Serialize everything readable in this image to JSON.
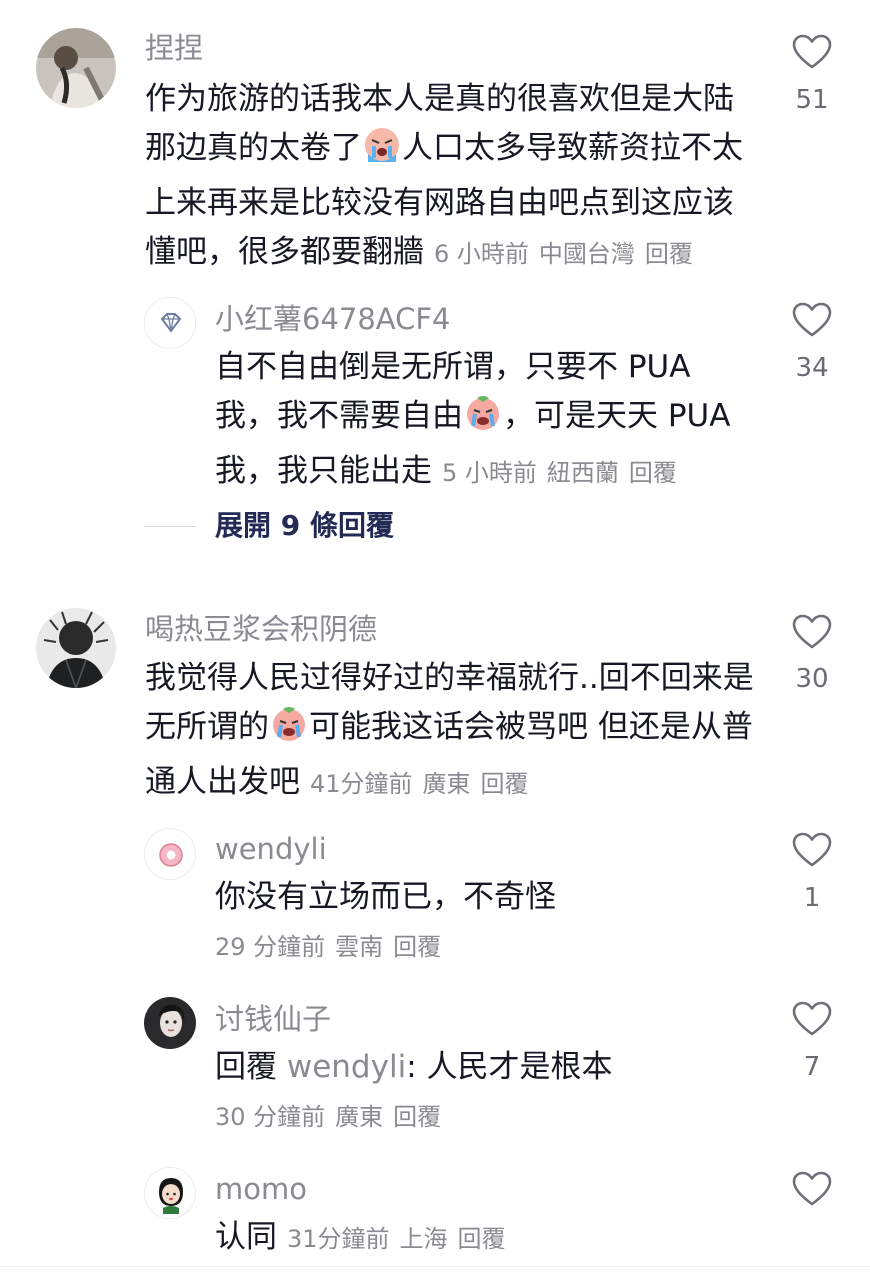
{
  "comments": [
    {
      "username": "捏捏",
      "lines": [
        "作为旅游的话我本人是真的很喜欢但是大陆",
        "那边真的太卷了",
        "人口太多导致薪资拉不太",
        "上来再来是比较没有网路自由吧点到这应该",
        "懂吧，很多都要翻牆"
      ],
      "time": "6 小時前",
      "location": "中國台灣",
      "reply": "回覆",
      "likes": "51",
      "emoji": "crying-face",
      "replies": [
        {
          "username": "小红薯6478ACF4",
          "lines": [
            "自不自由倒是无所谓，只要不 PUA",
            "我，我不需要自由",
            "，可是天天 PUA",
            "我，我只能出走"
          ],
          "time": "5 小時前",
          "location": "紐西蘭",
          "reply": "回覆",
          "likes": "34",
          "emoji": "crying-face"
        }
      ],
      "expand_label": "展開 9 條回覆"
    },
    {
      "username": "喝热豆浆会积阴德",
      "lines": [
        "我觉得人民过得好过的幸福就行..回不回来是",
        "无所谓的",
        "可能我这话会被骂吧 但还是从普",
        "通人出发吧"
      ],
      "time": "41分鐘前",
      "location": "廣東",
      "reply": "回覆",
      "likes": "30",
      "emoji": "crying-face",
      "replies": [
        {
          "username": "wendyli",
          "text": "你没有立场而已，不奇怪",
          "time": "29 分鐘前",
          "location": "雲南",
          "reply": "回覆",
          "likes": "1"
        },
        {
          "username": "讨钱仙子",
          "reply_prefix": "回覆",
          "reply_to": "wendyli",
          "text": ": 人民才是根本",
          "time": "30 分鐘前",
          "location": "廣東",
          "reply": "回覆",
          "likes": "7"
        },
        {
          "username": "momo",
          "text": "认同",
          "time": "31分鐘前",
          "location": "上海",
          "reply": "回覆",
          "likes": ""
        }
      ]
    }
  ],
  "colors": {
    "username": "#8a8b91",
    "text": "#161823",
    "expand": "#222a55",
    "divider": "#d8d8dc"
  },
  "icons": {
    "like": "heart-outline-icon",
    "emoji": "crying-face-emoji"
  }
}
